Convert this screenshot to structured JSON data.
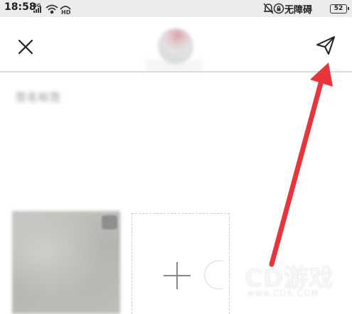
{
  "status_bar": {
    "time": "18:58",
    "network": "4G",
    "accessibility_label": "无障碍",
    "battery": "52"
  },
  "toolbar": {
    "close_icon": "close-icon",
    "send_icon": "send-icon"
  },
  "content": {
    "blurred_label": "签名标签",
    "add_icon": "plus-icon"
  },
  "annotation": {
    "arrow_color": "#e8343a"
  },
  "watermark": {
    "brand": "CD游戏",
    "url": "www.CD6.COM"
  }
}
